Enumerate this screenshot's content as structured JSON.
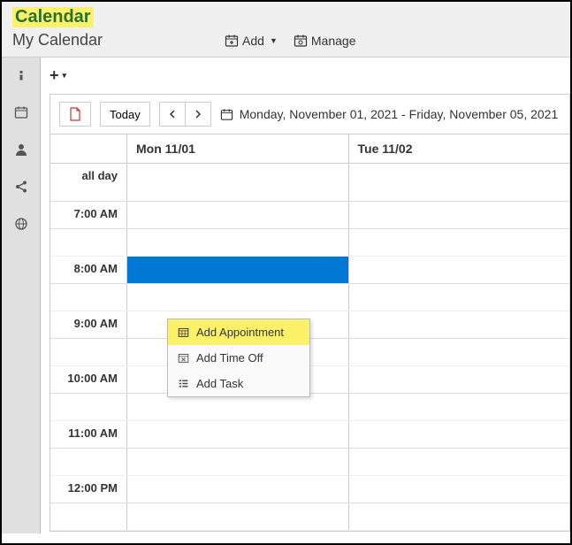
{
  "header": {
    "title": "Calendar",
    "subtitle": "My Calendar",
    "add_label": "Add",
    "manage_label": "Manage"
  },
  "toolbar": {
    "today_label": "Today",
    "date_range": "Monday, November 01, 2021 - Friday, November 05, 2021"
  },
  "days": [
    {
      "label": "Mon 11/01"
    },
    {
      "label": "Tue 11/02"
    }
  ],
  "all_day_label": "all day",
  "times": [
    "7:00 AM",
    "8:00 AM",
    "9:00 AM",
    "10:00 AM",
    "11:00 AM",
    "12:00 PM"
  ],
  "context_menu": {
    "add_appointment": "Add Appointment",
    "add_time_off": "Add Time Off",
    "add_task": "Add Task"
  }
}
